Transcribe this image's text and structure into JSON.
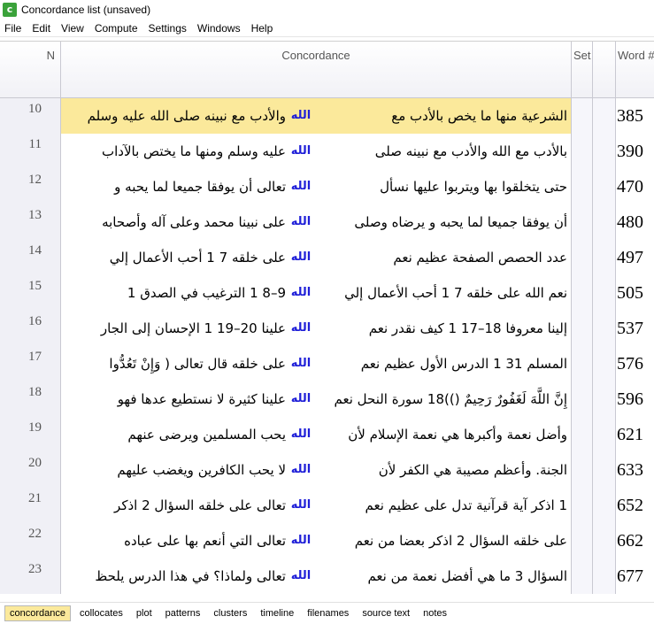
{
  "window": {
    "title": "Concordance list (unsaved)",
    "icon": "c-logo-icon"
  },
  "menu": [
    "File",
    "Edit",
    "View",
    "Compute",
    "Settings",
    "Windows",
    "Help"
  ],
  "columns": {
    "n": "N",
    "concordance": "Concordance",
    "set": "Set",
    "word": "Word #"
  },
  "keyword": "الله",
  "rows": [
    {
      "n": "10",
      "right": "الشرعية منها ما يخص بالأدب مع",
      "kw": "الله",
      "left": "والأدب مع نبينه صلى الله عليه وسلم",
      "word": "385",
      "selected": true
    },
    {
      "n": "11",
      "right": "بالأدب مع الله والأدب مع نبينه صلى",
      "kw": "الله",
      "left": "عليه وسلم ومنها ما يختص بالآداب",
      "word": "390"
    },
    {
      "n": "12",
      "right": "حتى يتخلقوا بها ويتربوا عليها نسأل",
      "kw": "الله",
      "left": "تعالى أن يوفقا جميعا لما يحبه و",
      "word": "470"
    },
    {
      "n": "13",
      "right": "أن يوفقا جميعا لما يحبه و يرضاه وصلى",
      "kw": "الله",
      "left": "على نبينا محمد وعلى آله وأصحابه",
      "word": "480"
    },
    {
      "n": "14",
      "right": "عدد الحصص الصفحة عظيم نعم",
      "kw": "الله",
      "left": "على خلقه 7 1 أحب الأعمال إلي",
      "word": "497"
    },
    {
      "n": "15",
      "right": "نعم الله على خلقه 7 1 أحب الأعمال إلي",
      "kw": "الله",
      "left": "9–8 1 الترغيب في الصدق 1",
      "word": "505"
    },
    {
      "n": "16",
      "right": "إلينا معروفا 18–17 1 كيف نقدر نعم",
      "kw": "الله",
      "left": "علينا 20–19 1 الإحسان إلى الجار",
      "word": "537"
    },
    {
      "n": "17",
      "right": "المسلم 31 1 الدرس الأول عظيم نعم",
      "kw": "الله",
      "left": "على خلقه قال تعالى ( وَإِنْ تَعُدُّوا",
      "word": "576"
    },
    {
      "n": "18",
      "right": "إِنَّ اللَّهَ لَغَفُورٌ رَحِيمٌ ())18 سورة النحل نعم",
      "kw": "الله",
      "left": "علينا كثيرة لا نستطيع عدها فهو",
      "word": "596"
    },
    {
      "n": "19",
      "right": "وأضل نعمة وأكبرها هي نعمة الإسلام لأن",
      "kw": "الله",
      "left": "يحب المسلمين ويرضى عنهم",
      "word": "621"
    },
    {
      "n": "20",
      "right": "الجنة. وأعظم مصيبة هي الكفر لأن",
      "kw": "الله",
      "left": "لا يحب الكافرين ويغضب عليهم",
      "word": "633"
    },
    {
      "n": "21",
      "right": "1 اذكر آية قرآنية تدل على عظيم نعم",
      "kw": "الله",
      "left": "تعالى على خلقه السؤال 2 اذكر",
      "word": "652"
    },
    {
      "n": "22",
      "right": "على خلقه السؤال 2 اذكر بعضا من نعم",
      "kw": "الله",
      "left": "تعالى التي أنعم بها على عباده",
      "word": "662"
    },
    {
      "n": "23",
      "right": "السؤال 3 ما هي أفضل نعمة من نعم",
      "kw": "الله",
      "left": "تعالى ولماذا؟ في هذا الدرس يلحظ",
      "word": "677"
    }
  ],
  "tabs": [
    "concordance",
    "collocates",
    "plot",
    "patterns",
    "clusters",
    "timeline",
    "filenames",
    "source text",
    "notes"
  ],
  "active_tab": "concordance",
  "colors": {
    "selected_row": "#fbe99b",
    "keyword": "#1f1fd8"
  }
}
